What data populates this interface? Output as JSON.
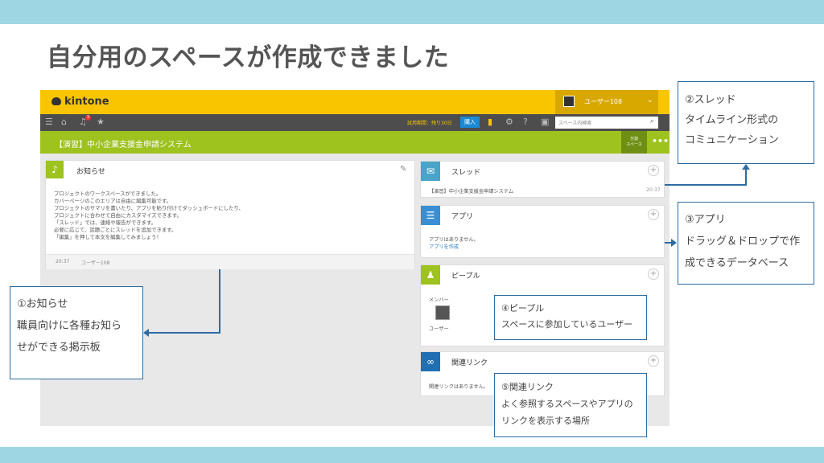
{
  "slide": {
    "title": "自分用のスペースが作成できました"
  },
  "kintone": {
    "logo": "kintone",
    "user_name": "ユーザー108",
    "notification_count": "3",
    "trial_text": "試用期間：残り30日",
    "buy_label": "購入",
    "search_placeholder": "スペース内検索",
    "space_name": "【演習】中小企業支援金申請システム",
    "share_label": "分割\nスペース",
    "notice": {
      "title": "お知らせ",
      "lines": [
        "プロジェクトのワークスペースができました。",
        "カバーページのこのエリアは自由に編集可能です。",
        "プロジェクトのサマリを書いたり、アプリを貼り付けてダッシュボードにしたり、",
        "プロジェクトに合わせて自由にカスタマイズできます。",
        "「スレッド」では、連絡や報告ができます。",
        "必要に応じて、話題ごとにスレッドを追加できます。",
        "「編集」を押して本文を編集してみましょう！"
      ],
      "footer_time": "20:37",
      "footer_user": "ユーザー108"
    },
    "thread": {
      "title": "スレッド",
      "item": "【演習】中小企業支援金申請システム",
      "time": "20:37"
    },
    "apps": {
      "title": "アプリ",
      "empty": "アプリはありません。",
      "create_link": "アプリを作成"
    },
    "people": {
      "title": "ピープル",
      "members_label": "メンバー",
      "member_name": "ユーザー"
    },
    "links": {
      "title": "関連リンク",
      "empty": "関連リンクはありません。"
    }
  },
  "callouts": {
    "notice": [
      "①お知らせ",
      "職員向けに各種お知ら",
      "せができる掲示板"
    ],
    "thread": [
      "②スレッド",
      "タイムライン形式の",
      "コミュニケーション"
    ],
    "apps": [
      "③アプリ",
      "ドラッグ＆ドロップで作",
      "成できるデータベース"
    ],
    "people": [
      "④ピープル",
      "スペースに参加しているユーザー"
    ],
    "links": [
      "⑤関連リンク",
      "よく参照するスペースやアプリの",
      "リンクを表示する場所"
    ]
  },
  "colors": {
    "header_yellow": "#f8c500",
    "space_green": "#9ec21e",
    "callout_border": "#2d6ca2",
    "band": "#9fd6e3"
  }
}
